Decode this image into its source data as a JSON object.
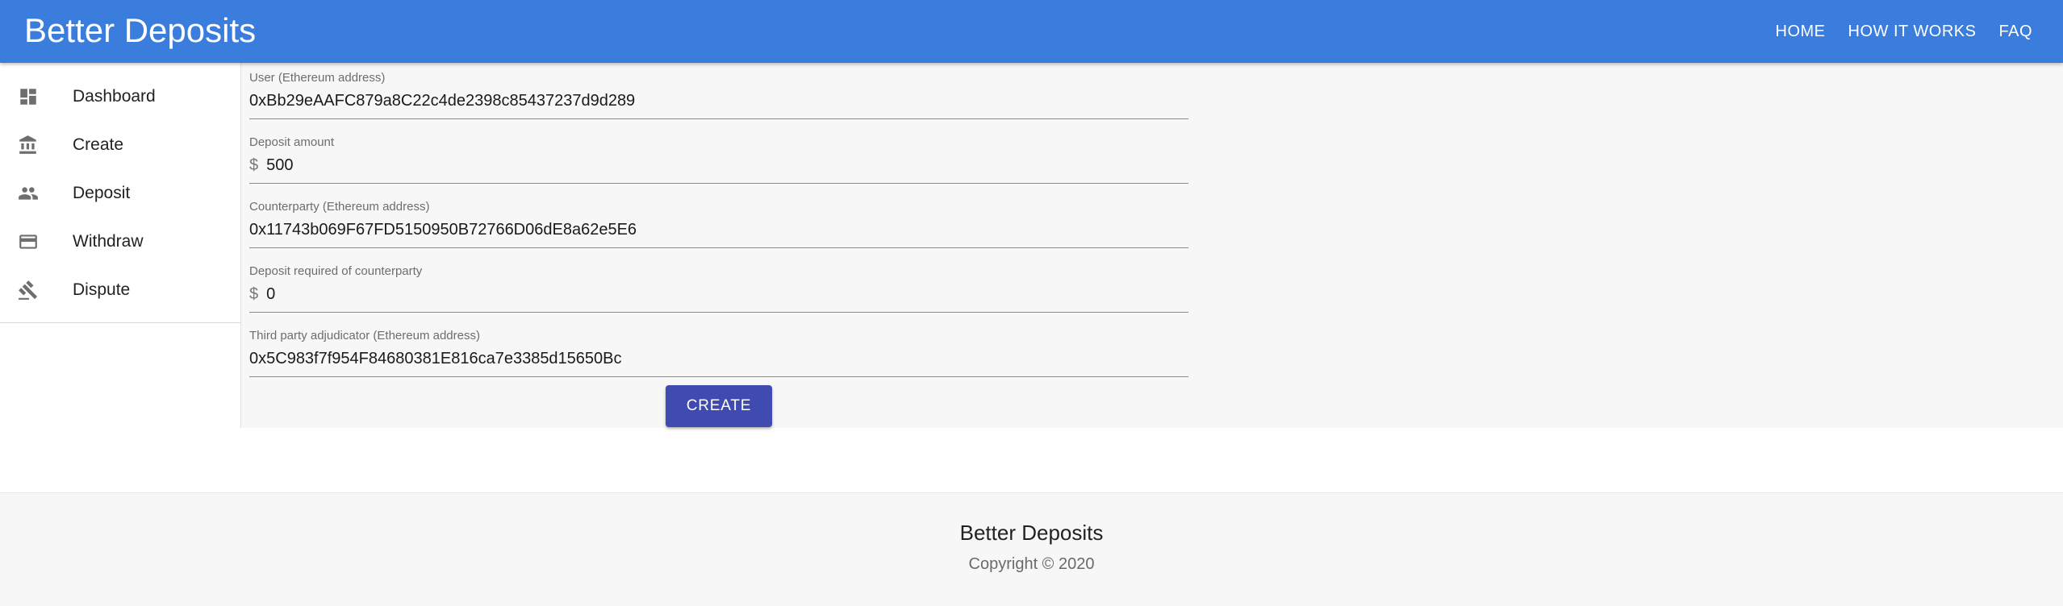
{
  "header": {
    "brand": "Better Deposits",
    "nav": [
      "HOME",
      "HOW IT WORKS",
      "FAQ"
    ]
  },
  "sidebar": {
    "items": [
      {
        "label": "Dashboard",
        "icon": "dashboard-icon"
      },
      {
        "label": "Create",
        "icon": "bank-icon"
      },
      {
        "label": "Deposit",
        "icon": "people-icon"
      },
      {
        "label": "Withdraw",
        "icon": "credit-card-icon"
      },
      {
        "label": "Dispute",
        "icon": "gavel-icon"
      }
    ]
  },
  "form": {
    "user_label": "User (Ethereum address)",
    "user_value": "0xBb29eAAFC879a8C22c4de2398c85437237d9d289",
    "deposit_label": "Deposit amount",
    "deposit_prefix": "$",
    "deposit_value": "500",
    "counterparty_label": "Counterparty (Ethereum address)",
    "counterparty_value": "0x11743b069F67FD5150950B72766D06dE8a62e5E6",
    "required_label": "Deposit required of counterparty",
    "required_prefix": "$",
    "required_value": "0",
    "adjudicator_label": "Third party adjudicator (Ethereum address)",
    "adjudicator_value": "0x5C983f7f954F84680381E816ca7e3385d15650Bc",
    "create_label": "CREATE"
  },
  "footer": {
    "title": "Better Deposits",
    "copyright": "Copyright © 2020"
  },
  "colors": {
    "appbar": "#3a7ddc",
    "button": "#3f4bb0"
  }
}
